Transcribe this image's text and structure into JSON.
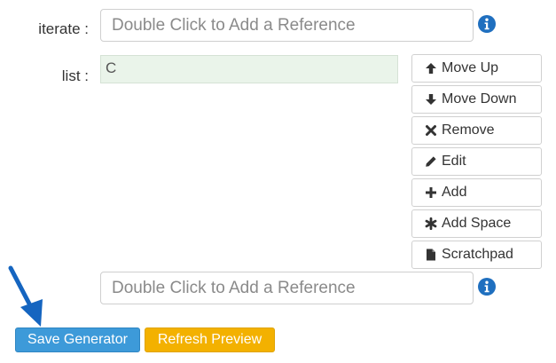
{
  "iterate": {
    "label": "iterate :",
    "placeholder": "Double Click to Add a Reference"
  },
  "list": {
    "label": "list :",
    "value": "C",
    "buttons": [
      {
        "label": "Move Up",
        "icon": "arrow-up-icon"
      },
      {
        "label": "Move Down",
        "icon": "arrow-down-icon"
      },
      {
        "label": "Remove",
        "icon": "times-icon"
      },
      {
        "label": "Edit",
        "icon": "pencil-icon"
      },
      {
        "label": "Add",
        "icon": "plus-icon"
      },
      {
        "label": "Add Space",
        "icon": "asterisk-icon"
      },
      {
        "label": "Scratchpad",
        "icon": "file-icon"
      }
    ]
  },
  "extra_reference": {
    "placeholder": "Double Click to Add a Reference"
  },
  "footer": {
    "save_label": "Save Generator",
    "refresh_label": "Refresh Preview"
  },
  "colors": {
    "info_icon": "#1f6fbf",
    "save_button": "#3d9ad9",
    "refresh_button": "#f3b100",
    "list_background": "#eaf4ea",
    "annotation_arrow": "#1565c0"
  }
}
